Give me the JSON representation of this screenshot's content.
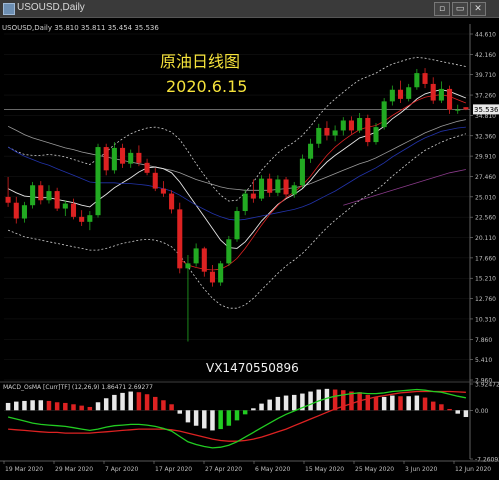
{
  "window": {
    "title": "USOUSD,Daily",
    "buttons": {
      "minimize": "▫",
      "restore": "▭",
      "close": "✕"
    }
  },
  "chart_data": {
    "type": "candlestick",
    "symbol_label": "USOUSD,Daily  35.810 35.811 35.454 35.536",
    "annotation_title": "原油日线图",
    "annotation_date": "2020.6.15",
    "watermark": "VX1470550896",
    "current_price": "35.536",
    "price_axis": {
      "min": 2.96,
      "max": 44.61,
      "ticks": [
        "44.610",
        "42.160",
        "39.710",
        "37.260",
        "34.810",
        "32.360",
        "29.910",
        "27.460",
        "25.010",
        "22.560",
        "20.110",
        "17.660",
        "15.210",
        "12.760",
        "10.310",
        "7.860",
        "5.410",
        "2.960"
      ]
    },
    "x_ticks": [
      "19 Mar 2020",
      "29 Mar 2020",
      "7 Apr 2020",
      "17 Apr 2020",
      "27 Apr 2020",
      "6 May 2020",
      "15 May 2020",
      "25 May 2020",
      "3 Jun 2020",
      "12 Jun 2020"
    ],
    "candles": [
      [
        25.0,
        27.4,
        23.8,
        24.3
      ],
      [
        24.3,
        25.0,
        21.8,
        22.4
      ],
      [
        22.4,
        24.4,
        21.9,
        24.0
      ],
      [
        24.0,
        26.8,
        23.6,
        26.4
      ],
      [
        26.4,
        26.9,
        24.1,
        24.6
      ],
      [
        24.6,
        26.4,
        24.2,
        25.7
      ],
      [
        25.7,
        26.1,
        23.3,
        23.6
      ],
      [
        23.6,
        24.6,
        22.7,
        24.2
      ],
      [
        24.2,
        24.8,
        22.3,
        22.6
      ],
      [
        22.6,
        23.4,
        21.5,
        22.0
      ],
      [
        22.0,
        23.3,
        21.0,
        22.8
      ],
      [
        22.8,
        31.4,
        22.5,
        31.0
      ],
      [
        31.0,
        31.4,
        27.6,
        28.2
      ],
      [
        28.2,
        31.6,
        27.8,
        30.9
      ],
      [
        30.9,
        31.4,
        28.5,
        29.0
      ],
      [
        29.0,
        30.7,
        28.5,
        30.3
      ],
      [
        30.3,
        31.2,
        28.7,
        29.1
      ],
      [
        29.1,
        29.6,
        27.6,
        27.9
      ],
      [
        27.9,
        28.5,
        25.7,
        26.0
      ],
      [
        26.0,
        26.9,
        25.0,
        25.4
      ],
      [
        25.4,
        25.8,
        23.0,
        23.5
      ],
      [
        23.5,
        24.3,
        15.8,
        16.4
      ],
      [
        16.4,
        18.0,
        7.6,
        17.0
      ],
      [
        17.0,
        19.4,
        16.6,
        18.8
      ],
      [
        18.8,
        19.0,
        15.4,
        16.0
      ],
      [
        16.0,
        16.8,
        14.2,
        14.7
      ],
      [
        14.7,
        17.3,
        14.3,
        17.0
      ],
      [
        17.0,
        20.3,
        16.7,
        19.9
      ],
      [
        19.9,
        23.8,
        19.6,
        23.3
      ],
      [
        23.3,
        25.9,
        22.8,
        25.4
      ],
      [
        25.4,
        27.1,
        24.3,
        24.8
      ],
      [
        24.8,
        27.6,
        24.5,
        27.2
      ],
      [
        27.2,
        27.8,
        25.0,
        25.5
      ],
      [
        25.5,
        27.6,
        25.1,
        27.1
      ],
      [
        27.1,
        27.4,
        25.0,
        25.3
      ],
      [
        25.3,
        26.8,
        24.9,
        26.4
      ],
      [
        26.4,
        30.1,
        26.1,
        29.6
      ],
      [
        29.6,
        32.0,
        29.1,
        31.4
      ],
      [
        31.4,
        33.8,
        30.9,
        33.3
      ],
      [
        33.3,
        34.1,
        31.8,
        32.4
      ],
      [
        32.4,
        33.6,
        31.7,
        33.0
      ],
      [
        33.0,
        34.6,
        32.4,
        34.2
      ],
      [
        34.2,
        34.7,
        32.6,
        33.0
      ],
      [
        33.0,
        35.1,
        32.7,
        34.5
      ],
      [
        34.5,
        34.9,
        31.1,
        31.6
      ],
      [
        31.6,
        33.9,
        31.3,
        33.4
      ],
      [
        33.4,
        36.9,
        33.1,
        36.5
      ],
      [
        36.5,
        38.4,
        36.0,
        37.9
      ],
      [
        37.9,
        39.0,
        36.3,
        36.8
      ],
      [
        36.8,
        38.6,
        36.5,
        38.2
      ],
      [
        38.2,
        40.4,
        37.9,
        39.9
      ],
      [
        39.9,
        40.5,
        38.1,
        38.6
      ],
      [
        38.6,
        39.4,
        36.2,
        36.6
      ],
      [
        36.6,
        38.9,
        36.3,
        38.0
      ],
      [
        38.0,
        38.4,
        35.0,
        35.5
      ],
      [
        35.5,
        36.1,
        35.0,
        35.5
      ],
      [
        35.8,
        35.8,
        35.45,
        35.54
      ]
    ],
    "series": [
      {
        "name": "MA-slow",
        "color": "#9b9b9b",
        "values": [
          33.5,
          33.0,
          32.5,
          32.1,
          31.8,
          31.5,
          31.2,
          30.9,
          30.7,
          30.4,
          30.2,
          30.0,
          29.8,
          29.6,
          29.4,
          29.2,
          29.0,
          28.8,
          28.6,
          28.4,
          28.2,
          27.9,
          27.5,
          27.1,
          26.8,
          26.5,
          26.2,
          26.0,
          25.9,
          25.8,
          25.8,
          25.8,
          25.8,
          25.9,
          26.0,
          26.1,
          26.3,
          26.6,
          27.0,
          27.4,
          27.8,
          28.2,
          28.6,
          29.0,
          29.3,
          29.7,
          30.2,
          30.7,
          31.2,
          31.7,
          32.2,
          32.7,
          33.1,
          33.5,
          33.8,
          34.1,
          34.3
        ]
      },
      {
        "name": "MA-fast",
        "color": "#e6e6e6",
        "values": [
          26.0,
          25.5,
          25.1,
          25.0,
          24.9,
          24.9,
          24.7,
          24.5,
          24.3,
          24.0,
          23.8,
          24.6,
          25.3,
          26.1,
          26.7,
          27.3,
          28.0,
          28.5,
          28.6,
          28.4,
          27.9,
          26.8,
          25.4,
          24.0,
          22.6,
          21.2,
          19.8,
          18.9,
          18.8,
          19.6,
          20.8,
          22.1,
          23.1,
          24.1,
          24.8,
          25.3,
          26.0,
          27.0,
          28.2,
          29.2,
          30.0,
          30.7,
          31.4,
          32.1,
          32.4,
          32.8,
          33.5,
          34.4,
          35.1,
          35.9,
          36.8,
          37.4,
          37.7,
          37.9,
          37.7,
          37.3,
          36.9
        ]
      },
      {
        "name": "Env-upper",
        "color": "#d0d0d0",
        "dash": "2,2",
        "values": [
          31.0,
          30.5,
          30.1,
          30.0,
          30.0,
          30.1,
          30.0,
          29.8,
          29.5,
          29.2,
          28.9,
          29.6,
          30.4,
          31.3,
          32.0,
          32.6,
          33.0,
          33.3,
          33.4,
          33.2,
          32.8,
          31.9,
          30.5,
          29.0,
          27.6,
          26.3,
          25.2,
          24.5,
          24.6,
          25.5,
          26.8,
          28.2,
          29.3,
          30.3,
          31.0,
          31.6,
          32.4,
          33.5,
          34.8,
          35.9,
          36.8,
          37.6,
          38.4,
          39.1,
          39.5,
          39.9,
          40.5,
          41.0,
          41.3,
          41.6,
          41.8,
          41.7,
          41.5,
          41.3,
          41.1,
          40.9,
          40.7
        ]
      },
      {
        "name": "Env-lower",
        "color": "#d0d0d0",
        "dash": "2,2",
        "values": [
          21.0,
          20.6,
          20.2,
          20.0,
          19.8,
          19.6,
          19.4,
          19.2,
          19.0,
          18.8,
          18.6,
          18.6,
          18.8,
          19.1,
          19.4,
          19.6,
          19.8,
          19.9,
          19.8,
          19.5,
          19.0,
          18.0,
          16.6,
          15.2,
          13.9,
          12.8,
          12.0,
          11.6,
          11.6,
          12.0,
          12.8,
          13.8,
          14.8,
          15.8,
          16.7,
          17.4,
          18.2,
          19.2,
          20.3,
          21.3,
          22.2,
          23.0,
          23.8,
          24.6,
          25.2,
          25.8,
          26.6,
          27.5,
          28.3,
          29.1,
          29.9,
          30.6,
          31.1,
          31.6,
          32.0,
          32.3,
          32.6
        ]
      },
      {
        "name": "MA-blue",
        "color": "#2233aa",
        "values": [
          31.0,
          30.4,
          29.9,
          29.5,
          29.1,
          28.8,
          28.4,
          28.0,
          27.6,
          27.2,
          26.8,
          26.7,
          26.7,
          26.7,
          26.6,
          26.6,
          26.5,
          26.4,
          26.2,
          26.0,
          25.7,
          25.2,
          24.6,
          24.0,
          23.5,
          23.0,
          22.6,
          22.3,
          22.2,
          22.3,
          22.5,
          22.7,
          22.9,
          23.1,
          23.3,
          23.5,
          23.8,
          24.2,
          24.7,
          25.2,
          25.7,
          26.3,
          26.9,
          27.5,
          28.0,
          28.5,
          29.1,
          29.8,
          30.4,
          31.0,
          31.6,
          32.1,
          32.5,
          32.9,
          33.1,
          33.3,
          33.4
        ]
      },
      {
        "name": "MA-purple",
        "color": "#8a3a8a",
        "values": [
          null,
          null,
          null,
          null,
          null,
          null,
          null,
          null,
          null,
          null,
          null,
          null,
          null,
          null,
          null,
          null,
          null,
          null,
          null,
          null,
          null,
          null,
          null,
          null,
          null,
          null,
          null,
          null,
          null,
          null,
          null,
          null,
          null,
          null,
          null,
          null,
          null,
          null,
          null,
          null,
          null,
          24.0,
          24.3,
          24.6,
          24.9,
          25.2,
          25.5,
          25.8,
          26.1,
          26.4,
          26.7,
          27.0,
          27.3,
          27.6,
          27.9,
          28.1,
          28.3
        ]
      },
      {
        "name": "MA-red",
        "color": "#dd2222",
        "values": [
          null,
          null,
          null,
          null,
          null,
          null,
          null,
          null,
          null,
          null,
          null,
          null,
          null,
          null,
          null,
          null,
          null,
          null,
          null,
          null,
          null,
          17.5,
          16.8,
          16.5,
          16.3,
          16.2,
          16.3,
          16.8,
          17.6,
          18.8,
          20.2,
          21.6,
          22.9,
          24.0,
          24.9,
          25.6,
          26.4,
          27.5,
          28.8,
          30.0,
          31.0,
          31.8,
          32.5,
          33.1,
          33.4,
          33.6,
          34.1,
          34.8,
          35.4,
          36.0,
          36.6,
          37.0,
          37.2,
          37.3,
          37.1,
          36.7,
          36.3
        ]
      }
    ],
    "macd": {
      "label": "MACD_OsMA [Curr]TF] (12,26,9) 1.86471 2.69277",
      "axis_ticks": [
        "3.92472",
        "0.00",
        "-7.26091"
      ],
      "hist": [
        1.1,
        1.3,
        1.4,
        1.5,
        1.5,
        1.4,
        1.2,
        1.1,
        0.9,
        0.7,
        0.5,
        1.2,
        1.8,
        2.3,
        2.6,
        2.8,
        2.7,
        2.4,
        2.0,
        1.5,
        0.9,
        -0.5,
        -1.8,
        -2.3,
        -2.7,
        -3.0,
        -2.8,
        -2.3,
        -1.5,
        -0.6,
        0.3,
        1.0,
        1.6,
        2.0,
        2.2,
        2.3,
        2.5,
        2.8,
        3.1,
        3.2,
        3.1,
        3.0,
        2.8,
        2.7,
        2.3,
        2.0,
        2.0,
        2.2,
        2.1,
        2.1,
        2.2,
        1.9,
        1.3,
        0.9,
        0.2,
        -0.5,
        -1.0
      ],
      "macd_line": [
        -1.0,
        -1.3,
        -1.6,
        -1.9,
        -2.1,
        -2.2,
        -2.3,
        -2.4,
        -2.6,
        -2.8,
        -3.0,
        -2.8,
        -2.5,
        -2.3,
        -2.2,
        -2.1,
        -2.1,
        -2.2,
        -2.4,
        -2.7,
        -3.1,
        -3.9,
        -4.7,
        -5.1,
        -5.4,
        -5.6,
        -5.5,
        -5.2,
        -4.7,
        -4.0,
        -3.3,
        -2.6,
        -1.9,
        -1.2,
        -0.6,
        -0.1,
        0.4,
        0.9,
        1.4,
        1.8,
        2.1,
        2.3,
        2.5,
        2.6,
        2.5,
        2.5,
        2.6,
        2.8,
        2.9,
        3.0,
        3.1,
        3.0,
        2.8,
        2.7,
        2.4,
        2.1,
        1.86
      ],
      "signal_line": [
        -2.8,
        -2.9,
        -3.0,
        -3.1,
        -3.2,
        -3.3,
        -3.3,
        -3.4,
        -3.4,
        -3.4,
        -3.4,
        -3.3,
        -3.2,
        -3.1,
        -3.0,
        -2.9,
        -2.8,
        -2.8,
        -2.8,
        -2.8,
        -2.9,
        -3.1,
        -3.4,
        -3.7,
        -4.0,
        -4.3,
        -4.5,
        -4.6,
        -4.6,
        -4.5,
        -4.3,
        -4.0,
        -3.6,
        -3.2,
        -2.8,
        -2.3,
        -1.8,
        -1.3,
        -0.8,
        -0.3,
        0.2,
        0.6,
        1.0,
        1.4,
        1.7,
        2.0,
        2.2,
        2.4,
        2.6,
        2.7,
        2.8,
        2.8,
        2.8,
        2.8,
        2.8,
        2.75,
        2.69
      ]
    }
  },
  "colors": {
    "background": "#000000",
    "grid": "#1a1a1a",
    "bull": "#22aa22",
    "bear": "#dd2222",
    "axis_text": "#bfbfbf",
    "annotation": "#f5e23b",
    "watermark": "#f0f0f0",
    "macd_line": "#22cc22",
    "signal_line": "#dd2222"
  }
}
